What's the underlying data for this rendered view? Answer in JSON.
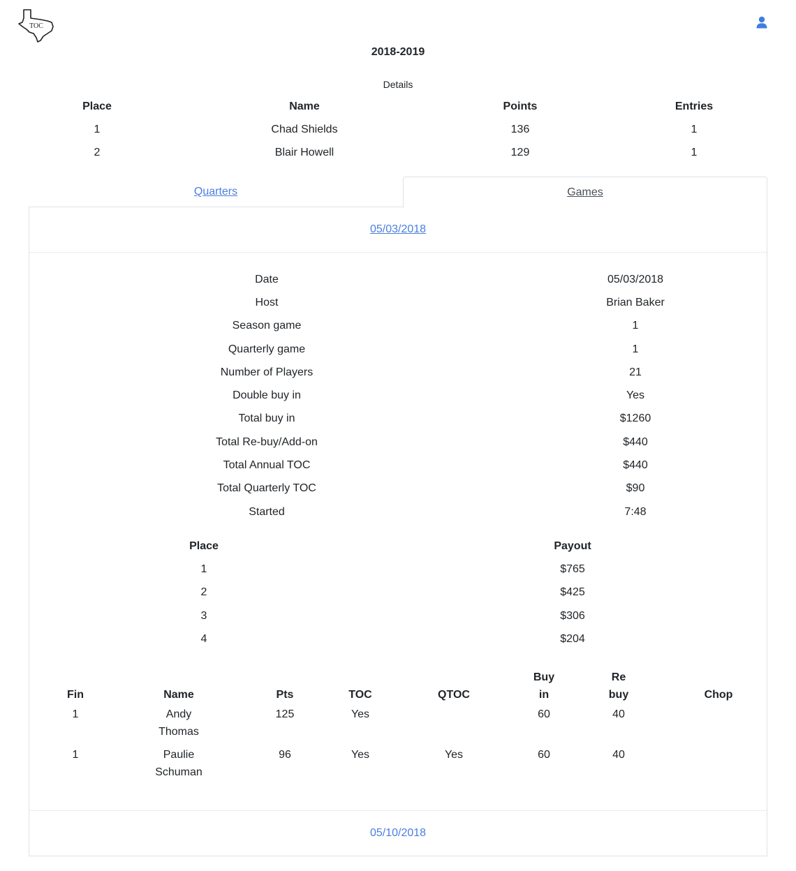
{
  "header": {
    "logo_text": "TOC",
    "season_title": "2018-2019",
    "details_label": "Details"
  },
  "standings": {
    "columns": [
      "Place",
      "Name",
      "Points",
      "Entries"
    ],
    "rows": [
      [
        "1",
        "Chad Shields",
        "136",
        "1"
      ],
      [
        "2",
        "Blair Howell",
        "129",
        "1"
      ]
    ]
  },
  "tabs": {
    "quarters": "Quarters",
    "games": "Games"
  },
  "games": [
    {
      "date_label": "05/03/2018",
      "details": [
        {
          "label": "Date",
          "value": "05/03/2018"
        },
        {
          "label": "Host",
          "value": "Brian Baker"
        },
        {
          "label": "Season game",
          "value": "1"
        },
        {
          "label": "Quarterly game",
          "value": "1"
        },
        {
          "label": "Number of Players",
          "value": "21"
        },
        {
          "label": "Double buy in",
          "value": "Yes"
        },
        {
          "label": "Total buy in",
          "value": "$1260"
        },
        {
          "label": "Total Re-buy/Add-on",
          "value": "$440"
        },
        {
          "label": "Total Annual TOC",
          "value": "$440"
        },
        {
          "label": "Total Quarterly TOC",
          "value": "$90"
        },
        {
          "label": "Started",
          "value": "7:48"
        }
      ],
      "payouts": {
        "columns": [
          "Place",
          "Payout"
        ],
        "rows": [
          [
            "1",
            "$765"
          ],
          [
            "2",
            "$425"
          ],
          [
            "3",
            "$306"
          ],
          [
            "4",
            "$204"
          ]
        ]
      },
      "players": {
        "columns": [
          "Fin",
          "Name",
          "Pts",
          "TOC",
          "QTOC",
          "Buy in",
          "Re buy",
          "Chop"
        ],
        "rows": [
          [
            "1",
            "Andy Thomas",
            "125",
            "Yes",
            "",
            "60",
            "40",
            ""
          ],
          [
            "1",
            "Paulie Schuman",
            "96",
            "Yes",
            "Yes",
            "60",
            "40",
            ""
          ]
        ]
      }
    },
    {
      "date_label": "05/10/2018"
    }
  ],
  "colors": {
    "link": "#4a7ee0",
    "text": "#212529",
    "border": "#dee2e6"
  },
  "icons": {
    "logo": "texas-map-logo",
    "user": "user-icon"
  }
}
